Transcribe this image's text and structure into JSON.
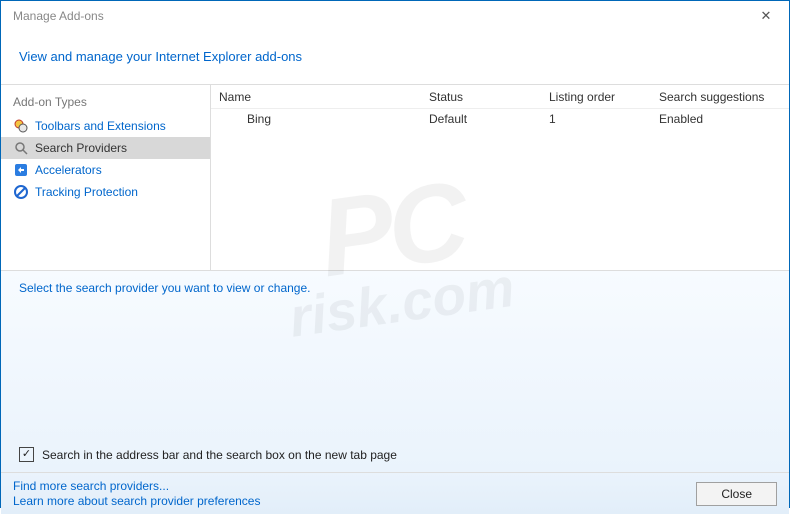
{
  "window": {
    "title": "Manage Add-ons"
  },
  "subtitle": "View and manage your Internet Explorer add-ons",
  "sidebar": {
    "header": "Add-on Types",
    "items": [
      {
        "label": "Toolbars and Extensions"
      },
      {
        "label": "Search Providers"
      },
      {
        "label": "Accelerators"
      },
      {
        "label": "Tracking Protection"
      }
    ]
  },
  "columns": {
    "name": "Name",
    "status": "Status",
    "listing": "Listing order",
    "search": "Search suggestions"
  },
  "rows": [
    {
      "name": "Bing",
      "status": "Default",
      "listing": "1",
      "search": "Enabled"
    }
  ],
  "details": {
    "prompt": "Select the search provider you want to view or change."
  },
  "checkbox": {
    "checked": "✓",
    "label": "Search in the address bar and the search box on the new tab page"
  },
  "footer": {
    "link1": "Find more search providers...",
    "link2": "Learn more about search provider preferences",
    "close": "Close"
  },
  "watermark": {
    "line1": "PC",
    "line2": "risk.com"
  }
}
